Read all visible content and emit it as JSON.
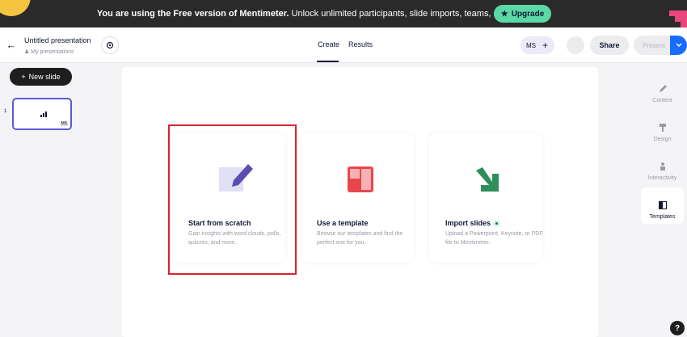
{
  "banner": {
    "message_bold": "You are using the Free version of Mentimeter.",
    "message_rest": "Unlock unlimited participants, slide imports, teams, and more.",
    "upgrade_label": "Upgrade",
    "brand_color": "#5ad8a6"
  },
  "header": {
    "presentation_title": "Untitled presentation",
    "breadcrumb": "My presentations",
    "tabs": [
      {
        "label": "Create",
        "active": true
      },
      {
        "label": "Results",
        "active": false
      }
    ],
    "collaborator_initials": "MS",
    "share_label": "Share",
    "present_label": "Present",
    "accent_color": "#196cff"
  },
  "sidebar": {
    "new_slide_label": "New slide",
    "slides": [
      {
        "number": "1",
        "badge": "MS"
      }
    ]
  },
  "start_options": [
    {
      "title": "Start from scratch",
      "description": "Gain insights with word clouds, polls, quizzes, and more.",
      "icon": "pencil-note-icon"
    },
    {
      "title": "Use a template",
      "description": "Browse our templates and find the perfect one for you.",
      "icon": "template-icon"
    },
    {
      "title": "Import slides",
      "description": "Upload a Powerpoint, Keynote, or PDF file to Mentimeter.",
      "icon": "import-arrow-icon"
    }
  ],
  "right_panel": [
    {
      "label": "Content",
      "icon": "pencil-icon",
      "active": false
    },
    {
      "label": "Design",
      "icon": "paint-roller-icon",
      "active": false
    },
    {
      "label": "Interactivity",
      "icon": "interactivity-icon",
      "active": false
    },
    {
      "label": "Templates",
      "icon": "templates-icon",
      "active": true
    }
  ],
  "help_label": "?"
}
